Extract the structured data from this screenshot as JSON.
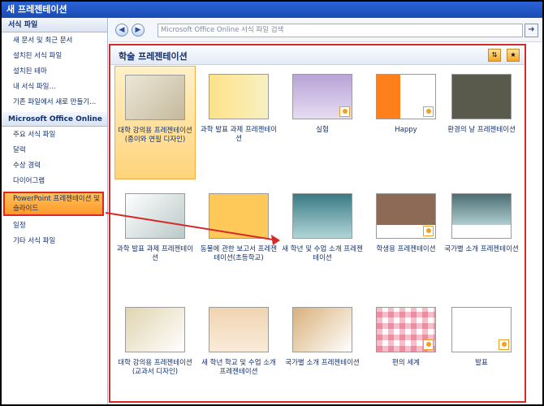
{
  "window": {
    "title": "새 프레젠테이션"
  },
  "sidebar": {
    "header1": "서식 파일",
    "items1": [
      {
        "label": "새 문서 및 최근 문서"
      },
      {
        "label": "설치된 서식 파일"
      },
      {
        "label": "설치된 테마"
      },
      {
        "label": "내 서식 파일..."
      },
      {
        "label": "기존 파일에서 새로 만들기..."
      }
    ],
    "header2": "Microsoft Office Online",
    "items2": [
      {
        "label": "주요 서식 파일"
      },
      {
        "label": "달력"
      },
      {
        "label": "수상 경력"
      },
      {
        "label": "다이어그램"
      },
      {
        "label": "PowerPoint 프레젠테이션 및 슬라이드",
        "selected": true
      },
      {
        "label": "일정"
      },
      {
        "label": "기타 서식 파일"
      }
    ]
  },
  "toolbar": {
    "back_icon": "back-icon",
    "forward_icon": "forward-icon",
    "search_placeholder": "Microsoft Office Online 서식 파일 검색",
    "go_icon": "arrow-right-icon"
  },
  "gallery": {
    "title": "학술 프레젠테이션",
    "tiles": [
      {
        "label": "대학 강의용 프레젠테이션(종이와 연필 디자인)",
        "selected": true
      },
      {
        "label": "과학 발표 과제 프레젠테이션"
      },
      {
        "label": "실험"
      },
      {
        "label": "Happy"
      },
      {
        "label": "환경의 날 프레젠테이션"
      },
      {
        "label": "과학 발표 과제 프레젠테이션"
      },
      {
        "label": "동물에 관한 보고서 프레젠테이션(초등학교)"
      },
      {
        "label": "새 학년 및 수업 소개 프레젠테이션"
      },
      {
        "label": "학생용 프레젠테이션"
      },
      {
        "label": "국가별 소개 프레젠테이션"
      },
      {
        "label": "대학 강의용 프레젠테이션(교과서 디자인)"
      },
      {
        "label": "새 학년 학교 및 수업 소개 프레젠테이션"
      },
      {
        "label": "국가별 소개 프레젠테이션"
      },
      {
        "label": "편의 세계"
      },
      {
        "label": "발표"
      }
    ]
  },
  "colors": {
    "highlight_red": "#d42a2a",
    "selection_orange": "#ff9a2a",
    "title_blue": "#1a4bb5"
  }
}
